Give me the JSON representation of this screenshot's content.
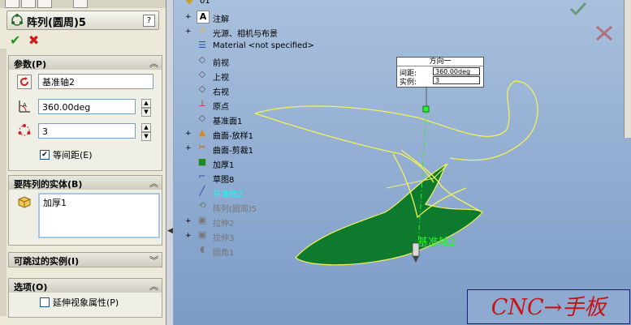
{
  "property_manager": {
    "title": "阵列(圆周)5",
    "help": "?",
    "ok": "✔",
    "cancel": "✖"
  },
  "sections": {
    "params": {
      "label": "参数(P)",
      "chevron": "︽"
    },
    "bodies": {
      "label": "要阵列的实体(B)",
      "chevron": "︽"
    },
    "skip": {
      "label": "可跳过的实例(I)",
      "chevron": "︾"
    },
    "options": {
      "label": "选项(O)",
      "chevron": "︽"
    }
  },
  "params": {
    "axis_value": "基准轴2",
    "angle_value": "360.00deg",
    "count_value": "3",
    "equal_spacing_label": "等间距(E)",
    "equal_spacing_checked": true
  },
  "bodies": {
    "items": [
      "加厚1"
    ]
  },
  "options": {
    "propagate_label": "延伸视象属性(P)",
    "propagate_checked": false
  },
  "tree": {
    "root": "01",
    "items": [
      {
        "label": "注解",
        "expander": "+"
      },
      {
        "label": "光源、相机与布景",
        "expander": "+"
      },
      {
        "label": "Material <not specified>",
        "expander": ""
      },
      {
        "label": "前视",
        "expander": ""
      },
      {
        "label": "上视",
        "expander": ""
      },
      {
        "label": "右视",
        "expander": ""
      },
      {
        "label": "原点",
        "expander": ""
      },
      {
        "label": "基准面1",
        "expander": ""
      },
      {
        "label": "曲面-放样1",
        "expander": "+"
      },
      {
        "label": "曲面-剪裁1",
        "expander": "+"
      },
      {
        "label": "加厚1",
        "expander": ""
      },
      {
        "label": "草图8",
        "expander": ""
      },
      {
        "label": "基准轴2",
        "expander": ""
      },
      {
        "label": "阵列(圆周)5",
        "expander": ""
      },
      {
        "label": "拉伸2",
        "expander": "+"
      },
      {
        "label": "拉伸3",
        "expander": "+"
      },
      {
        "label": "圆角1",
        "expander": ""
      }
    ]
  },
  "callout": {
    "header": "方向一",
    "spacing_label": "间距:",
    "spacing_value": "360.00deg",
    "instances_label": "实例:",
    "instances_value": "3"
  },
  "viewport": {
    "axis_label": "基准轴2",
    "watermark": "CNC→手板"
  },
  "colors": {
    "part_fill": "#0d7a2e",
    "highlight": "#f2f25a",
    "axis": "#2af22a"
  }
}
